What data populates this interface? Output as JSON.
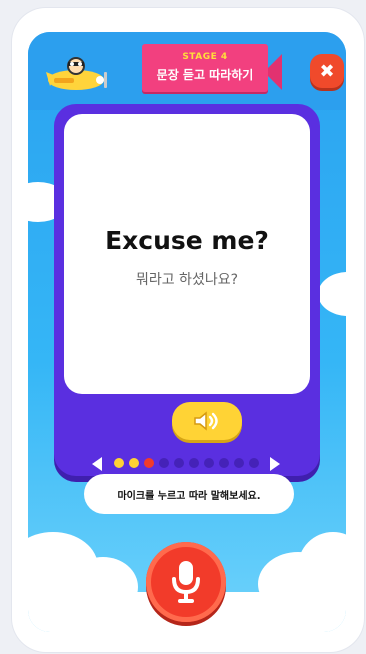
{
  "header": {
    "stage": "STAGE 4",
    "title": "문장 듣고 따라하기",
    "close_glyph": "✖"
  },
  "card": {
    "english": "Excuse me?",
    "korean": "뭐라고 하셨나요?"
  },
  "pager": {
    "total": 10,
    "current": 3,
    "colors": {
      "done": "#ffd335",
      "current": "#f23b2a",
      "todo": "#4522b8"
    }
  },
  "hint": {
    "text": "마이크를 누르고 따라 말해보세요."
  },
  "icons": {
    "close": "close-icon",
    "sound": "speaker-icon",
    "mic": "microphone-icon",
    "prev": "chevron-left-icon",
    "next": "chevron-right-icon"
  }
}
